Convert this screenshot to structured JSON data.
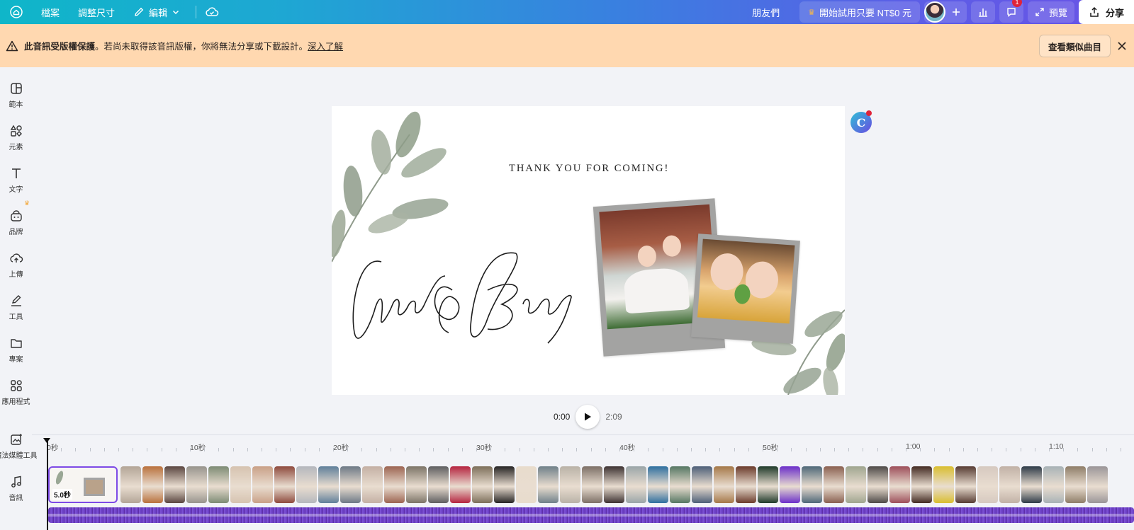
{
  "topbar": {
    "menu": [
      "檔案",
      "調整尺寸",
      "編輯"
    ],
    "friends": "朋友們",
    "trial": "開始試用只要 NT$0 元",
    "comment_badge": "1",
    "preview": "預覽",
    "share": "分享"
  },
  "notice": {
    "bold": "此音訊受版權保護",
    "text": "。若尚未取得該音訊版權，你將無法分享或下載設計。",
    "link": "深入了解",
    "button": "查看類似曲目"
  },
  "sidebar": {
    "items": [
      {
        "label": "範本",
        "icon": "template-icon"
      },
      {
        "label": "元素",
        "icon": "elements-icon"
      },
      {
        "label": "文字",
        "icon": "text-icon"
      },
      {
        "label": "品牌",
        "icon": "brand-icon"
      },
      {
        "label": "上傳",
        "icon": "upload-icon"
      },
      {
        "label": "工具",
        "icon": "draw-icon"
      },
      {
        "label": "專案",
        "icon": "folder-icon"
      },
      {
        "label": "應用程式",
        "icon": "apps-icon"
      },
      {
        "label": "魔法媒體工具",
        "icon": "magic-media-icon"
      },
      {
        "label": "音訊",
        "icon": "music-icon"
      }
    ]
  },
  "canvas": {
    "title": "THANK YOU FOR COMING!",
    "script_text": "Chaya & Barry"
  },
  "playback": {
    "current": "0:00",
    "total": "2:09"
  },
  "timeline": {
    "ticks": [
      "0秒",
      "10秒",
      "20秒",
      "30秒",
      "40秒",
      "50秒",
      "1:00",
      "1:10"
    ],
    "first_clip_duration": "5.0秒",
    "clip_colors": [
      "#b3a597",
      "#b9713c",
      "#5a4640",
      "#97948d",
      "#7d8b74",
      "#d6c3b0",
      "#c9a087",
      "#8e4a3d",
      "#b4b7bd",
      "#5f7f9a",
      "#6d7986",
      "#c4b0a4",
      "#9c6451",
      "#7c7467",
      "#5e5e60",
      "#b5243f",
      "#7d6f5a",
      "#262424",
      "#e8dccc",
      "#6f8089",
      "#b9b2a7",
      "#7c6f66",
      "#3d3232",
      "#9aa5a8",
      "#2e6f9f",
      "#557763",
      "#4d5f78",
      "#a57848",
      "#6b3b2b",
      "#1f3a2a",
      "#6b2fc9",
      "#4e6878",
      "#8a6050",
      "#9fa58f",
      "#4e4a48",
      "#9d4e5a",
      "#432b22",
      "#d9be2f",
      "#573c33",
      "#d6c9c0",
      "#c1b1a6",
      "#2e3b48",
      "#a8b2b6",
      "#8e7d68",
      "#9a9598"
    ]
  }
}
